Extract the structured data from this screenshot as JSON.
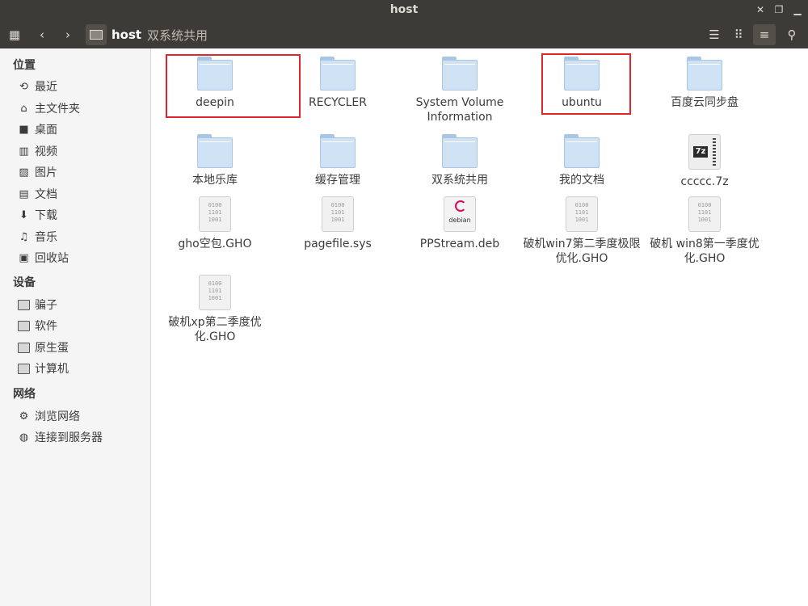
{
  "window": {
    "title": "host"
  },
  "toolbar": {
    "crumbs": {
      "location": "host",
      "subfolder": "双系统共用"
    }
  },
  "sidebar": {
    "sections": {
      "places": "位置",
      "devices": "设备",
      "network": "网络"
    },
    "places": [
      "最近",
      "主文件夹",
      "桌面",
      "视频",
      "图片",
      "文档",
      "下载",
      "音乐",
      "回收站"
    ],
    "devices": [
      "骗子",
      "软件",
      "原生蛋",
      "计算机"
    ],
    "network": [
      "浏览网络",
      "连接到服务器"
    ]
  },
  "files": [
    {
      "name": "deepin",
      "type": "folder",
      "highlighted": true
    },
    {
      "name": "RECYCLER",
      "type": "folder"
    },
    {
      "name": "System Volume Information",
      "type": "folder"
    },
    {
      "name": "ubuntu",
      "type": "folder",
      "highlighted": true
    },
    {
      "name": "百度云同步盘",
      "type": "folder"
    },
    {
      "name": "本地乐库",
      "type": "folder"
    },
    {
      "name": "缓存管理",
      "type": "folder"
    },
    {
      "name": "双系统共用",
      "type": "folder"
    },
    {
      "name": "我的文档",
      "type": "folder"
    },
    {
      "name": "ccccc.7z",
      "type": "archive-7z"
    },
    {
      "name": "gho空包.GHO",
      "type": "binary"
    },
    {
      "name": "pagefile.sys",
      "type": "binary"
    },
    {
      "name": "PPStream.deb",
      "type": "debian-package"
    },
    {
      "name": "破机win7第二季度极限优化.GHO",
      "type": "binary"
    },
    {
      "name": "破机 win8第一季度优化.GHO",
      "type": "binary"
    },
    {
      "name": "破机xp第二季度优化.GHO",
      "type": "binary"
    }
  ],
  "icons": {
    "binary_text": "0100\n1101\n1001",
    "archive_badge": "7z",
    "debian_label": "debian"
  },
  "colors": {
    "highlight_box": "#e0262a",
    "titlebar": "#3c3b37",
    "folder": "#cfe2f4"
  }
}
